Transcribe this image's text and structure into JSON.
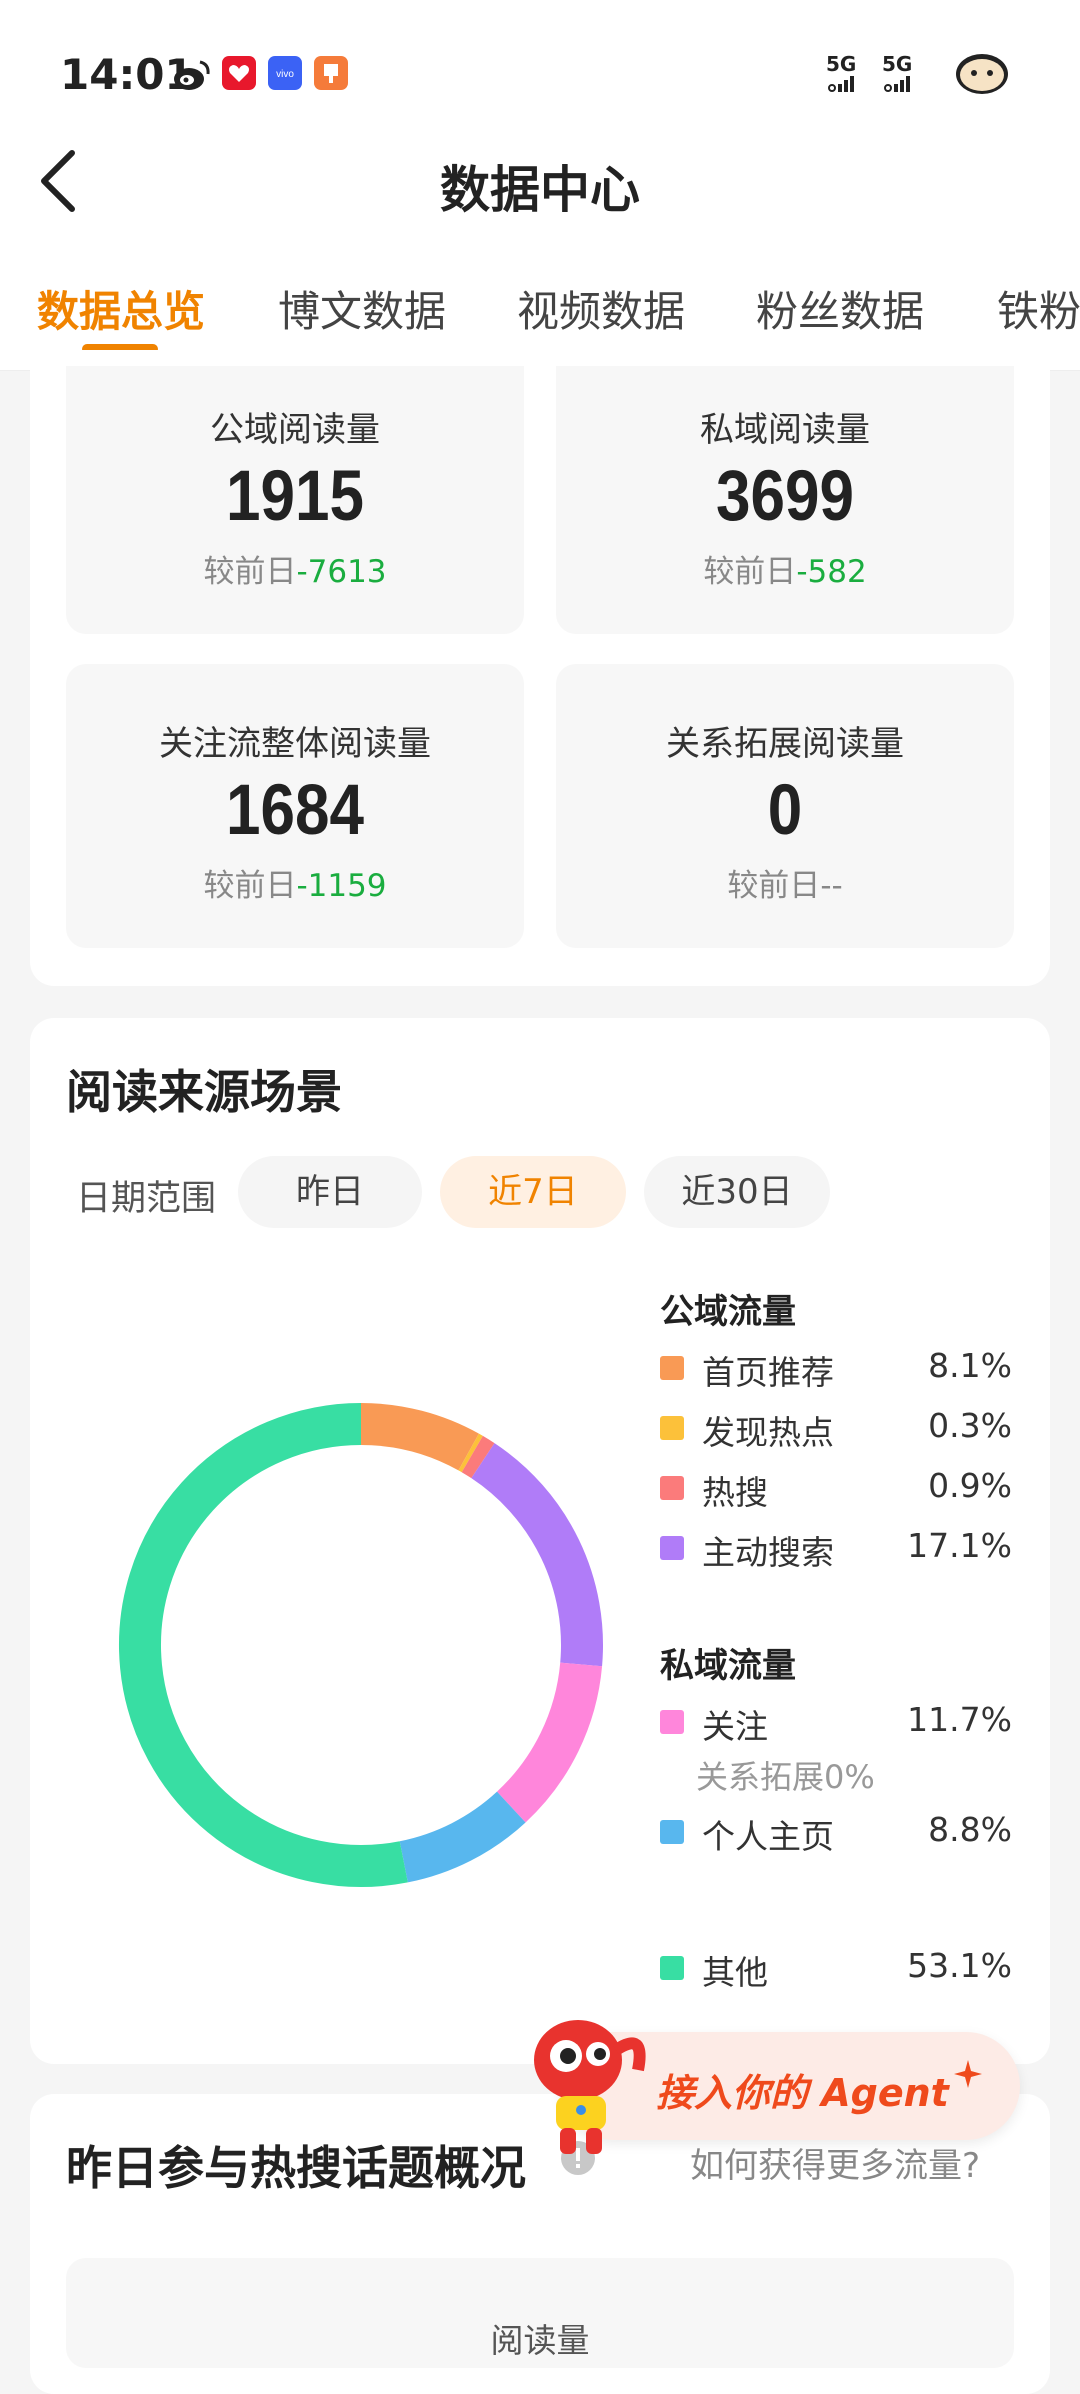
{
  "status_bar": {
    "time": "14:01",
    "signal_1": "5G",
    "signal_2": "5G",
    "app_icons": [
      "weibo-icon",
      "heart-app-icon",
      "vivo-icon",
      "note-app-icon"
    ]
  },
  "header": {
    "title": "数据中心",
    "back_icon": "chevron-left-icon"
  },
  "tabs": [
    {
      "label": "数据总览"
    },
    {
      "label": "博文数据"
    },
    {
      "label": "视频数据"
    },
    {
      "label": "粉丝数据"
    },
    {
      "label": "铁粉"
    }
  ],
  "metrics": [
    {
      "label": "公域阅读量",
      "value": "1915",
      "compare_prefix": "较前日",
      "delta": "-7613"
    },
    {
      "label": "私域阅读量",
      "value": "3699",
      "compare_prefix": "较前日",
      "delta": "-582"
    },
    {
      "label": "关注流整体阅读量",
      "value": "1684",
      "compare_prefix": "较前日",
      "delta": "-1159"
    },
    {
      "label": "关系拓展阅读量",
      "value": "0",
      "compare_prefix": "较前日",
      "delta": "--"
    }
  ],
  "read_source": {
    "title": "阅读来源场景",
    "date_range_label": "日期范围",
    "ranges": [
      "昨日",
      "近7日",
      "近30日"
    ],
    "selected_range": "近7日",
    "public_title": "公域流量",
    "private_title": "私域流量",
    "relation_note": "关系拓展0%"
  },
  "chart_data": {
    "type": "pie",
    "categories": [
      "首页推荐",
      "发现热点",
      "热搜",
      "主动搜索",
      "关注",
      "个人主页",
      "其他"
    ],
    "values": [
      8.1,
      0.3,
      0.9,
      17.1,
      11.7,
      8.8,
      53.1
    ],
    "labels": [
      "8.1%",
      "0.3%",
      "0.9%",
      "17.1%",
      "11.7%",
      "8.8%",
      "53.1%"
    ],
    "colors": [
      "#f99a55",
      "#fcc13a",
      "#fb7b7b",
      "#b07cf8",
      "#ff86db",
      "#58b7ee",
      "#38dea3"
    ],
    "groups": {
      "公域流量": [
        0,
        1,
        2,
        3
      ],
      "私域流量": [
        4,
        5
      ],
      "other": [
        6
      ]
    },
    "donut": true
  },
  "agent_banner": {
    "text": "接入你的 Agent"
  },
  "hot_topics": {
    "title": "昨日参与热搜话题概况",
    "link": "如何获得更多流量?",
    "read_label": "阅读量"
  }
}
